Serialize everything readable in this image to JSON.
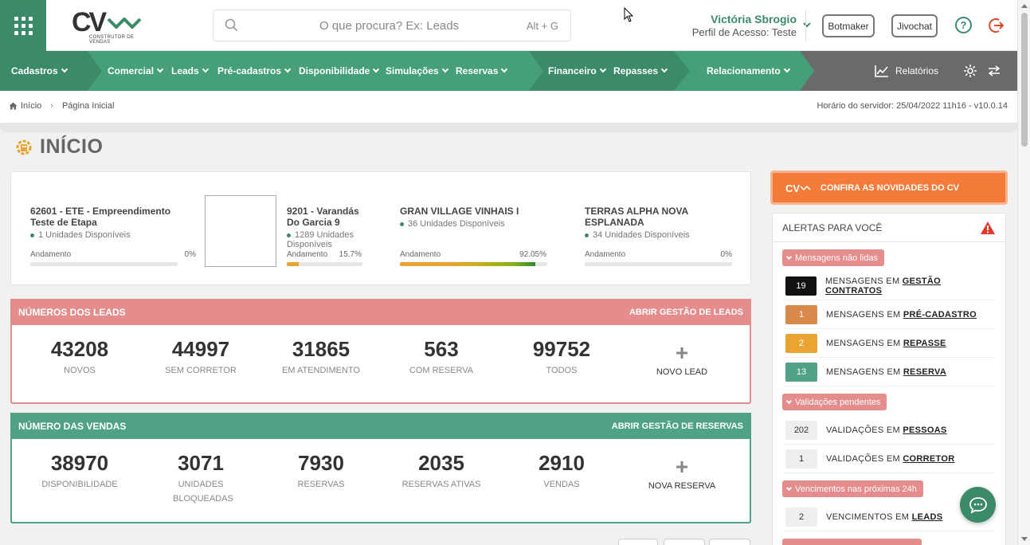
{
  "colors": {
    "brand_green": "#3b8a68",
    "nav_green": "#45a079",
    "leads_header": "#e58c8c",
    "sales_header": "#4fa384",
    "news_orange": "#f47b3a"
  },
  "header": {
    "logo_text": "CV",
    "logo_tagline": "CONSTRUTOR DE VENDAS",
    "search_placeholder": "O que procura? Ex: Leads",
    "search_shortcut": "Alt + G",
    "user_name": "Victória Sbrogio",
    "user_profile": "Perfil de Acesso: Teste",
    "botmaker_label": "Botmaker",
    "jivochat_label": "Jivochat",
    "help_label": "?"
  },
  "nav": {
    "items": [
      "Cadastros",
      "Comercial",
      "Leads",
      "Pré-cadastros",
      "Disponibilidade",
      "Simulações",
      "Reservas",
      "Financeiro",
      "Repasses",
      "Relacionamento"
    ],
    "reports_label": "Relatórios"
  },
  "breadcrumb": {
    "home": "Início",
    "current": "Página Inicial",
    "server_time": "Horário do servidor: 25/04/2022 11h16 - v10.0.14"
  },
  "page_title": "INÍCIO",
  "projects": [
    {
      "name": "62601 - ETE - Empreendimento Teste de Etapa",
      "units": "1 Unidades Disponíveis",
      "progress_label": "Andamento",
      "progress_text": "0%",
      "progress": 0
    },
    {
      "name": "9201 - Varandás Do Garcia 9",
      "units": "1289 Unidades Disponíveis",
      "progress_label": "Andamento",
      "progress_text": "15.7%",
      "progress": 15.7
    },
    {
      "name": "GRAN VILLAGE VINHAIS I",
      "units": "36 Unidades Disponíveis",
      "progress_label": "Andamento",
      "progress_text": "92.05%",
      "progress": 92.05
    },
    {
      "name": "TERRAS ALPHA NOVA ESPLANADA",
      "units": "34 Unidades Disponíveis",
      "progress_label": "Andamento",
      "progress_text": "0%",
      "progress": 0
    }
  ],
  "leads_card": {
    "title": "NÚMEROS DOS LEADS",
    "link": "ABRIR GESTÃO DE LEADS",
    "stats": [
      {
        "value": "43208",
        "label": "NOVOS"
      },
      {
        "value": "44997",
        "label": "SEM CORRETOR"
      },
      {
        "value": "31865",
        "label": "EM ATENDIMENTO"
      },
      {
        "value": "563",
        "label": "COM RESERVA"
      },
      {
        "value": "99752",
        "label": "TODOS"
      }
    ],
    "add_label": "NOVO LEAD"
  },
  "sales_card": {
    "title": "NÚMERO DAS VENDAS",
    "link": "ABRIR GESTÃO DE RESERVAS",
    "stats": [
      {
        "value": "38970",
        "label": "DISPONIBILIDADE"
      },
      {
        "value": "3071",
        "label": "UNIDADES BLOQUEADAS"
      },
      {
        "value": "7930",
        "label": "RESERVAS"
      },
      {
        "value": "2035",
        "label": "RESERVAS ATIVAS"
      },
      {
        "value": "2910",
        "label": "VENDAS"
      }
    ],
    "add_label": "NOVA RESERVA"
  },
  "news_button": "CONFIRA AS NOVIDADES DO CV",
  "alerts": {
    "title": "ALERTAS PARA VOCÊ",
    "groups": [
      {
        "label": "Mensagens não lidas",
        "rows": [
          {
            "count": "19",
            "prefix": "MENSAGENS EM",
            "link": "GESTÃO CONTRATOS",
            "bg": "#111111",
            "fg": "#ffffff"
          },
          {
            "count": "1",
            "prefix": "MENSAGENS EM",
            "link": "PRÉ-CADASTRO",
            "bg": "#d9894a",
            "fg": "#ffffff"
          },
          {
            "count": "2",
            "prefix": "MENSAGENS EM",
            "link": "REPASSE",
            "bg": "#e9a431",
            "fg": "#ffffff"
          },
          {
            "count": "13",
            "prefix": "MENSAGENS EM",
            "link": "RESERVA",
            "bg": "#4fa384",
            "fg": "#ffffff"
          }
        ]
      },
      {
        "label": "Validações pendentes",
        "rows": [
          {
            "count": "202",
            "prefix": "VALIDAÇÕES EM",
            "link": "PESSOAS",
            "bg": "#eeeeee",
            "fg": "#333333"
          },
          {
            "count": "1",
            "prefix": "VALIDAÇÕES EM",
            "link": "CORRETOR",
            "bg": "#eeeeee",
            "fg": "#333333"
          }
        ]
      },
      {
        "label": "Vencimentos nas próximas 24h",
        "rows": [
          {
            "count": "2",
            "prefix": "VENCIMENTOS EM",
            "link": "LEADS",
            "bg": "#eeeeee",
            "fg": "#333333"
          }
        ]
      }
    ]
  }
}
